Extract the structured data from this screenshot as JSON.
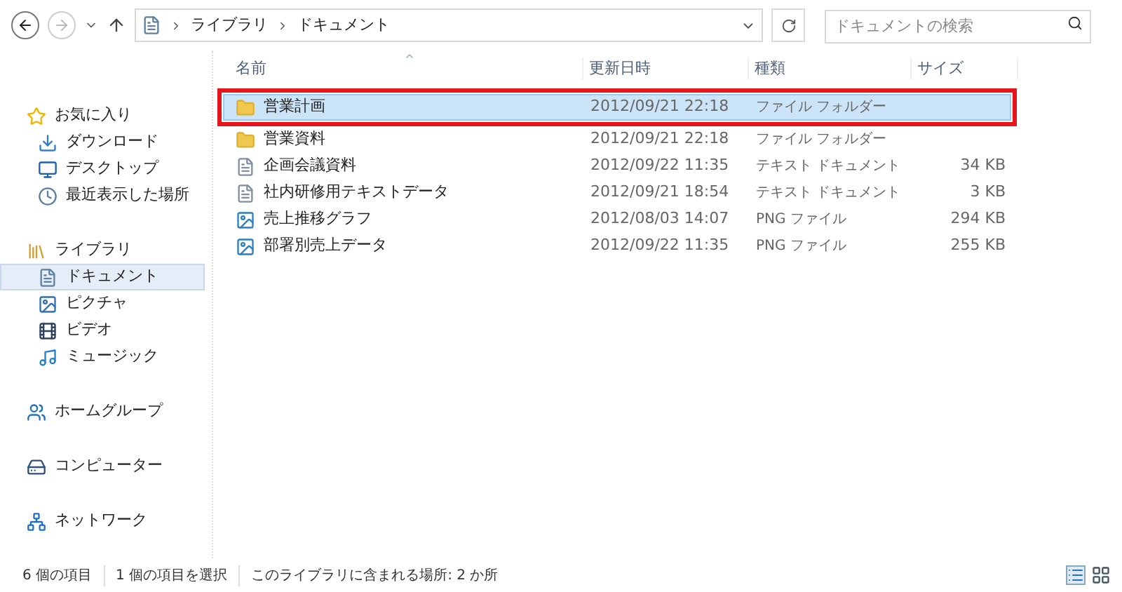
{
  "address_bar": {
    "path": [
      "ライブラリ",
      "ドキュメント"
    ]
  },
  "search": {
    "placeholder": "ドキュメントの検索"
  },
  "sidebar": {
    "groups": [
      {
        "items": [
          {
            "label": "お気に入り",
            "kind": "star",
            "selected": false,
            "children": [
              {
                "label": "ダウンロード",
                "kind": "download",
                "selected": false
              },
              {
                "label": "デスクトップ",
                "kind": "desktop",
                "selected": false
              },
              {
                "label": "最近表示した場所",
                "kind": "recent",
                "selected": false
              }
            ]
          }
        ]
      },
      {
        "items": [
          {
            "label": "ライブラリ",
            "kind": "library",
            "selected": false,
            "children": [
              {
                "label": "ドキュメント",
                "kind": "document",
                "selected": true
              },
              {
                "label": "ピクチャ",
                "kind": "picture",
                "selected": false
              },
              {
                "label": "ビデオ",
                "kind": "video",
                "selected": false
              },
              {
                "label": "ミュージック",
                "kind": "music",
                "selected": false
              }
            ]
          }
        ]
      },
      {
        "items": [
          {
            "label": "ホームグループ",
            "kind": "homegroup",
            "selected": false
          }
        ]
      },
      {
        "items": [
          {
            "label": "コンピューター",
            "kind": "computer",
            "selected": false
          }
        ]
      },
      {
        "items": [
          {
            "label": "ネットワーク",
            "kind": "network",
            "selected": false
          }
        ]
      }
    ]
  },
  "table": {
    "columns": [
      "名前",
      "更新日時",
      "種類",
      "サイズ"
    ],
    "rows": [
      {
        "name": "営業計画",
        "date": "2012/09/21 22:18",
        "type": "ファイル フォルダー",
        "kind": "folder",
        "selected": true,
        "highlighted": true
      },
      {
        "name": "営業資料",
        "date": "2012/09/21 22:18",
        "type": "ファイル フォルダー",
        "kind": "folder",
        "selected": false,
        "highlighted": false
      },
      {
        "name": "企画会議資料",
        "date": "2012/09/22 11:35",
        "type": "テキスト ドキュメント",
        "size": "34 KB",
        "kind": "text",
        "selected": false,
        "highlighted": false
      },
      {
        "name": "社内研修用テキストデータ",
        "date": "2012/09/21 18:54",
        "type": "テキスト ドキュメント",
        "size": "3 KB",
        "kind": "text",
        "selected": false,
        "highlighted": false
      },
      {
        "name": "売上推移グラフ",
        "date": "2012/08/03 14:07",
        "type": "PNG ファイル",
        "size": "294 KB",
        "kind": "image",
        "selected": false,
        "highlighted": false
      },
      {
        "name": "部署別売上データ",
        "date": "2012/09/22 11:35",
        "type": "PNG ファイル",
        "size": "255 KB",
        "kind": "image",
        "selected": false,
        "highlighted": false
      }
    ]
  },
  "status_bar": [
    "6 個の項目",
    "1 個の項目を選択",
    "このライブラリに含まれる場所: 2 か所"
  ]
}
